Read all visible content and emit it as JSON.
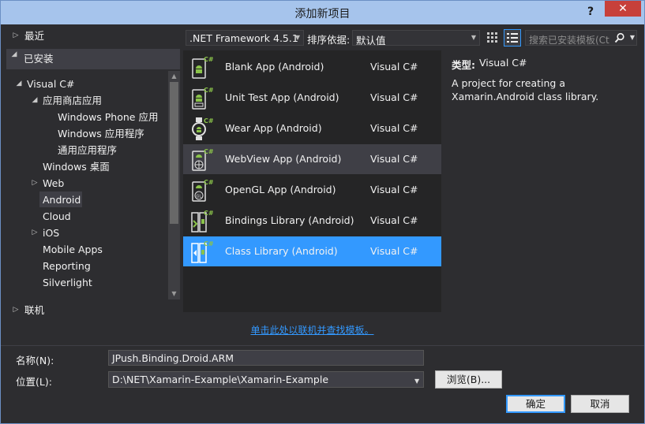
{
  "window": {
    "title": "添加新项目",
    "help": "?",
    "close": "✕"
  },
  "tree": {
    "recent": "最近",
    "installed": "已安装",
    "items": [
      {
        "label": "Visual C#"
      },
      {
        "label": "应用商店应用"
      },
      {
        "label": "Windows Phone 应用"
      },
      {
        "label": "Windows 应用程序"
      },
      {
        "label": "通用应用程序"
      },
      {
        "label": "Windows 桌面"
      },
      {
        "label": "Web"
      },
      {
        "label": "Android"
      },
      {
        "label": "Cloud"
      },
      {
        "label": "iOS"
      },
      {
        "label": "Mobile Apps"
      },
      {
        "label": "Reporting"
      },
      {
        "label": "Silverlight"
      }
    ],
    "online": "联机"
  },
  "toolbar": {
    "framework": ".NET Framework 4.5.1",
    "sort_label": "排序依据:",
    "sort_value": "默认值",
    "search_placeholder": "搜索已安装模板(Ct"
  },
  "templates": [
    {
      "name": "Blank App (Android)",
      "lang": "Visual C#"
    },
    {
      "name": "Unit Test App (Android)",
      "lang": "Visual C#"
    },
    {
      "name": "Wear App (Android)",
      "lang": "Visual C#"
    },
    {
      "name": "WebView App (Android)",
      "lang": "Visual C#"
    },
    {
      "name": "OpenGL App (Android)",
      "lang": "Visual C#"
    },
    {
      "name": "Bindings Library (Android)",
      "lang": "Visual C#"
    },
    {
      "name": "Class Library (Android)",
      "lang": "Visual C#"
    }
  ],
  "online_link": "单击此处以联机并查找模板。",
  "info": {
    "type_label": "类型:",
    "type_value": "Visual C#",
    "description": "A project for creating a Xamarin.Android class library."
  },
  "form": {
    "name_label": "名称(N):",
    "name_value": "JPush.Binding.Droid.ARM",
    "location_label": "位置(L):",
    "location_value": "D:\\NET\\Xamarin-Example\\Xamarin-Example",
    "browse": "浏览(B)...",
    "ok": "确定",
    "cancel": "取消"
  },
  "colors": {
    "accent": "#3399ff",
    "android_green": "#8bc34a",
    "dark_bg": "#2d2d30"
  }
}
